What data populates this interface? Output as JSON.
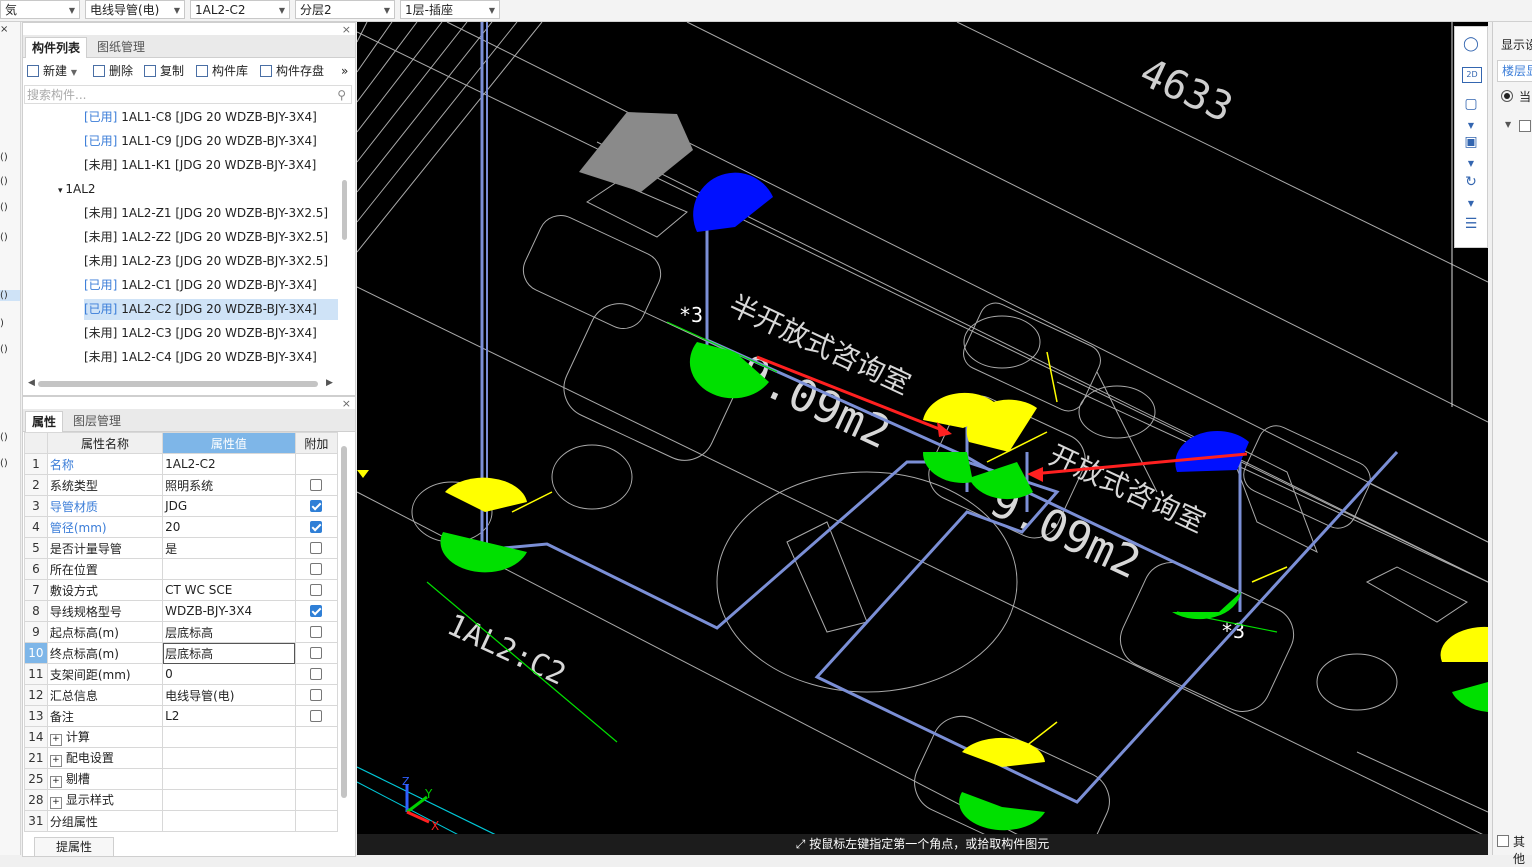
{
  "topbar": {
    "dropdowns": [
      "気",
      "电线导管(电)",
      "1AL2-C2",
      "分层2",
      "1层-插座"
    ]
  },
  "left_edge": {
    "glyphs": [
      ")",
      "()",
      "()",
      "()",
      "()",
      "()",
      ")",
      "()",
      "()",
      "()",
      "()"
    ]
  },
  "component_panel": {
    "tabs": [
      "构件列表",
      "图纸管理"
    ],
    "toolbar": {
      "new": "新建",
      "delete": "删除",
      "copy": "复制",
      "library": "构件库",
      "save": "构件存盘",
      "more": "»"
    },
    "search_placeholder": "搜索构件...",
    "tree": [
      {
        "status": "[已用]",
        "text": "1AL1-C8 [JDG 20 WDZB-BJY-3X4]",
        "used": true
      },
      {
        "status": "[已用]",
        "text": "1AL1-C9 [JDG 20 WDZB-BJY-3X4]",
        "used": true
      },
      {
        "status": "[未用]",
        "text": "1AL1-K1 [JDG 20 WDZB-BJY-3X4]",
        "used": false
      },
      {
        "status": "",
        "text": "1AL2",
        "group": true
      },
      {
        "status": "[未用]",
        "text": "1AL2-Z1 [JDG 20 WDZB-BJY-3X2.5]",
        "used": false
      },
      {
        "status": "[未用]",
        "text": "1AL2-Z2 [JDG 20 WDZB-BJY-3X2.5]",
        "used": false
      },
      {
        "status": "[未用]",
        "text": "1AL2-Z3 [JDG 20 WDZB-BJY-3X2.5]",
        "used": false
      },
      {
        "status": "[已用]",
        "text": "1AL2-C1 [JDG 20 WDZB-BJY-3X4]",
        "used": true
      },
      {
        "status": "[已用]",
        "text": "1AL2-C2 [JDG 20 WDZB-BJY-3X4]",
        "used": true,
        "selected": true
      },
      {
        "status": "[未用]",
        "text": "1AL2-C3 [JDG 20 WDZB-BJY-3X4]",
        "used": false
      },
      {
        "status": "[未用]",
        "text": "1AL2-C4 [JDG 20 WDZB-BJY-3X4]",
        "used": false
      }
    ]
  },
  "property_panel": {
    "tabs": [
      "属性",
      "图层管理"
    ],
    "headers": [
      "属性名称",
      "属性值",
      "附加"
    ],
    "rows": [
      {
        "num": "1",
        "name": "名称",
        "value": "1AL2-C2",
        "blue": true,
        "check": null
      },
      {
        "num": "2",
        "name": "系统类型",
        "value": "照明系统",
        "blue": false,
        "check": false
      },
      {
        "num": "3",
        "name": "导管材质",
        "value": "JDG",
        "blue": true,
        "check": true
      },
      {
        "num": "4",
        "name": "管径(mm)",
        "value": "20",
        "blue": true,
        "check": true
      },
      {
        "num": "5",
        "name": "是否计量导管",
        "value": "是",
        "blue": false,
        "check": false
      },
      {
        "num": "6",
        "name": "所在位置",
        "value": "",
        "blue": false,
        "check": false
      },
      {
        "num": "7",
        "name": "敷设方式",
        "value": "CT WC SCE",
        "blue": false,
        "check": false
      },
      {
        "num": "8",
        "name": "导线规格型号",
        "value": "WDZB-BJY-3X4",
        "blue": false,
        "check": true
      },
      {
        "num": "9",
        "name": "起点标高(m)",
        "value": "层底标高",
        "blue": false,
        "check": false
      },
      {
        "num": "10",
        "name": "终点标高(m)",
        "value": "层底标高",
        "blue": false,
        "check": false,
        "active": true
      },
      {
        "num": "11",
        "name": "支架间距(mm)",
        "value": "0",
        "blue": false,
        "check": false
      },
      {
        "num": "12",
        "name": "汇总信息",
        "value": "电线导管(电)",
        "blue": false,
        "check": false
      },
      {
        "num": "13",
        "name": "备注",
        "value": "L2",
        "blue": false,
        "check": false
      },
      {
        "num": "14",
        "name": "计算",
        "value": "",
        "expand": true,
        "check": null
      },
      {
        "num": "21",
        "name": "配电设置",
        "value": "",
        "expand": true,
        "check": null
      },
      {
        "num": "25",
        "name": "剔槽",
        "value": "",
        "expand": true,
        "check": null
      },
      {
        "num": "28",
        "name": "显示样式",
        "value": "",
        "expand": true,
        "check": null
      },
      {
        "num": "31",
        "name": "分组属性",
        "value": "",
        "expand": false,
        "check": null
      }
    ],
    "bottom_button": "提属性"
  },
  "cad": {
    "labels": {
      "room_number": "4633",
      "pipe_tag": "1AL2:C2",
      "room_a": "半开放式咨询室",
      "room_b": "开放式咨询室",
      "area_a": "9.09m2",
      "area_b": "9.09m2",
      "count_a": "*3",
      "count_b": "*3",
      "axis_x": "X",
      "axis_y": "Y",
      "axis_z": "Z"
    },
    "status_text": "按鼠标左键指定第一个角点，或拾取构件图元",
    "colors": {
      "pipe": "#7b8fd6",
      "yellow": "#ffff00",
      "green": "#00e000",
      "blue": "#0010ff",
      "red": "#ff2020",
      "gray": "#808080"
    }
  },
  "vtools": {
    "icons": [
      "orbit-icon",
      "2d-icon",
      "cube-top-icon",
      "cube-persp-icon",
      "rotate-icon",
      "display-settings-icon"
    ],
    "label_2d": "2D"
  },
  "right_panel": {
    "title": "显示设",
    "tab": "楼层显",
    "radio_label": "当",
    "other": "其他"
  }
}
